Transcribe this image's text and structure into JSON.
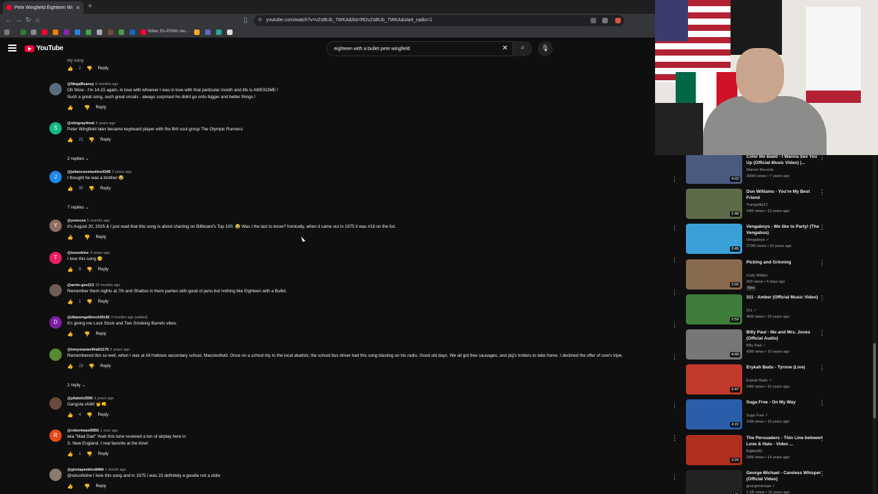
{
  "browser": {
    "tab_title": "Pete Wingfield Eighteen With",
    "url": "youtube.com/watch?v=vZsBUb_7WKA&list=RDvZsBUb_7WKA&start_radio=1",
    "bookmark_label": "Video: Ex-POWs reu..."
  },
  "youtube": {
    "logo": "YouTube",
    "search_query": "eighteen with a bullet pete wingfield"
  },
  "comments": {
    "prev_text": "My Song",
    "prev_likes": "2",
    "items": [
      {
        "handle": "@MegaBeansy",
        "time": "6 months ago",
        "text1": "Oh Wow - I'm 14-15 again, in love with whoever I was in love with that particular month  and life is AWESOME !",
        "text2": "Such a great song, such great vocals - always surprised he didnt go onto bigger and better things !",
        "likes": "",
        "avatar_color": "#5a6d7e",
        "initial": ""
      },
      {
        "handle": "@stingray4real",
        "time": "5 years ago",
        "text1": "Peter Wingfield later became keyboard player with the Brit soul group The Olympic Runners",
        "text2": "",
        "likes": "21",
        "avatar_color": "#12b886",
        "initial": "S",
        "replies": "2 replies"
      },
      {
        "handle": "@julianconstantino4349",
        "time": "2 years ago",
        "text1": "I thought he was a brother 😂",
        "text2": "",
        "likes": "30",
        "avatar_color": "#1e88e5",
        "initial": "J",
        "replies": "7 replies"
      },
      {
        "handle": "@yveecea",
        "time": "5 months ago",
        "text1": "It's August 20, 2025 & I just read that this song is about charting on Billboard's Top 100. 😂 Was I the last to know? Ironically, when it came out in 1975 it was #18 on the list.",
        "text2": "",
        "likes": "",
        "avatar_color": "#8d6e63",
        "initial": "Y"
      },
      {
        "handle": "@tsunshine",
        "time": "4 years ago",
        "text1": "I love this song 😊",
        "text2": "",
        "likes": "9",
        "avatar_color": "#e91e63",
        "initial": "T"
      },
      {
        "handle": "@arnie-gee213",
        "time": "10 months ago",
        "text1": "Remember them nights at 7th and Shattoo in them parties with good ol jams but nothing like Eighteen with a Bullet.",
        "text2": "",
        "likes": "1",
        "avatar_color": "#6d5c58",
        "initial": ""
      },
      {
        "handle": "@dilanengelbrecht9145",
        "time": "3 months ago (edited)",
        "text1": "It's giving me Lock Stock and Two Smoking Barrels vibes",
        "text2": "",
        "likes": "",
        "avatar_color": "#7b1fa2",
        "initial": "D"
      },
      {
        "handle": "@tonymaxwellhatt1175",
        "time": "2 years ago",
        "text1": "Remembered this so well, when I was at All Hallows secondary school, Macclesfield. Once on a school trip to the local abattoir, the school bus driver had this song blasting on his radio. Good old days. We all got free sausages, and pig's trotters to take home. I declined the offer of cow's tripe.",
        "text2": "",
        "likes": "23",
        "avatar_color": "#558b2f",
        "initial": "",
        "replies": "1 reply"
      },
      {
        "handle": "@pltalolo2595",
        "time": "3 years ago",
        "text1": "Gangsta shiiit! 🤟👊",
        "text2": "",
        "likes": "4",
        "avatar_color": "#6a4a3a",
        "initial": ""
      },
      {
        "handle": "@robertmasi9955",
        "time": "1 year ago",
        "text1": "aka \"Mad Dad\" Yeah this tune received a ton of airplay here in",
        "text2": "S. New England.  I real favorite at the time!",
        "likes": "1",
        "avatar_color": "#e64a19",
        "initial": "R"
      },
      {
        "handle": "@gloriapeebles8484",
        "time": "1 month ago",
        "text1": "@siriusfeline I love this song and in 1975 I was 23 definitely  a goodie not a oldie",
        "text2": "",
        "likes": "",
        "avatar_color": "#8a7c70",
        "initial": ""
      }
    ],
    "reply_label": "Reply"
  },
  "sidebar": {
    "videos": [
      {
        "title": "Color Me Badd - I Wanna Sex You Up (Official Music Video) |...",
        "channel": "Warner Records",
        "meta": "206M views • 7 years ago",
        "duration": "4:03",
        "thumb": "#4a5a80"
      },
      {
        "title": "Don Williams - You're My Best Friend",
        "channel": "Tranquility12",
        "meta": "14M views • 13 years ago",
        "duration": "2:48",
        "thumb": "#5d6b4a"
      },
      {
        "title": "Vengaboys - We like to Party! (The Vengabus)",
        "channel": "Vengaboys ✓",
        "meta": "272M views • 16 years ago",
        "duration": "3:45",
        "thumb": "#3aa0d8"
      },
      {
        "title": "Picking and Grinning",
        "channel": "Cody Walker",
        "meta": "203 views • 4 days ago",
        "duration": "2:02",
        "thumb": "#8a6a4e",
        "badge": "New"
      },
      {
        "title": "311 - Amber (Official Music Video)",
        "channel": "311 ✓",
        "meta": "46M views • 16 years ago",
        "duration": "2:59",
        "thumb": "#3e7d3a"
      },
      {
        "title": "Billy Paul - Me and Mrs. Jones (Official Audio)",
        "channel": "Billy Paul ✓",
        "meta": "43M views • 10 years ago",
        "duration": "4:49",
        "thumb": "#777777"
      },
      {
        "title": "Erykah Badu - Tyrone (Live)",
        "channel": "Erykah Badu ✓",
        "meta": "24M views • 16 years ago",
        "duration": "3:47",
        "thumb": "#c0392b"
      },
      {
        "title": "Suga Free - On My Way",
        "channel": "Suga Free ✓",
        "meta": "10M views • 16 years ago",
        "duration": "4:22",
        "thumb": "#2a5ea8"
      },
      {
        "title": "The Persuaders - Thin Line between Love & Hate - Video ...",
        "channel": "Bigbird39",
        "meta": "26M views • 14 years ago",
        "duration": "3:24",
        "thumb": "#b03020"
      },
      {
        "title": "George Michael - Careless Whisper (Official Video)",
        "channel": "georgemichael ✓",
        "meta": "1.5B views • 16 years ago",
        "duration": "HD",
        "thumb": "#222222"
      }
    ]
  },
  "colors": {
    "background": "#0f0f0f",
    "brand_red": "#ff0033"
  }
}
